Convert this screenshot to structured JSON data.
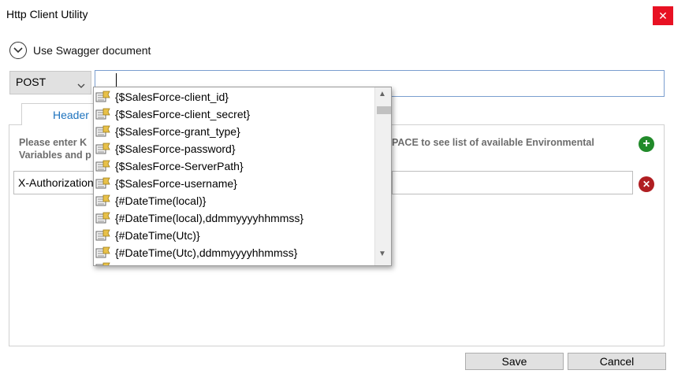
{
  "window": {
    "title": "Http Client Utility"
  },
  "swagger": {
    "label": "Use Swagger document"
  },
  "request": {
    "method": "POST",
    "url": ""
  },
  "tabs": [
    {
      "label": "Header"
    }
  ],
  "hint": {
    "left_line1": "Please enter K",
    "left_line2": "Variables and p",
    "right_line1": "PACE to see list of available Environmental",
    "right_line2": ""
  },
  "headers": [
    {
      "key": "X-Authorization",
      "value": ""
    }
  ],
  "autocomplete": {
    "items": [
      "{$SalesForce-client_id}",
      "{$SalesForce-client_secret}",
      "{$SalesForce-grant_type}",
      "{$SalesForce-password}",
      "{$SalesForce-ServerPath}",
      "{$SalesForce-username}",
      "{#DateTime(local)}",
      "{#DateTime(local),ddmmyyyyhhmmss}",
      "{#DateTime(Utc)}",
      "{#DateTime(Utc),ddmmyyyyhhmmss}"
    ]
  },
  "buttons": {
    "save": "Save",
    "cancel": "Cancel"
  },
  "colors": {
    "close": "#e81123",
    "add": "#218a2a",
    "remove": "#b01e22",
    "tab_text": "#1e73be"
  }
}
